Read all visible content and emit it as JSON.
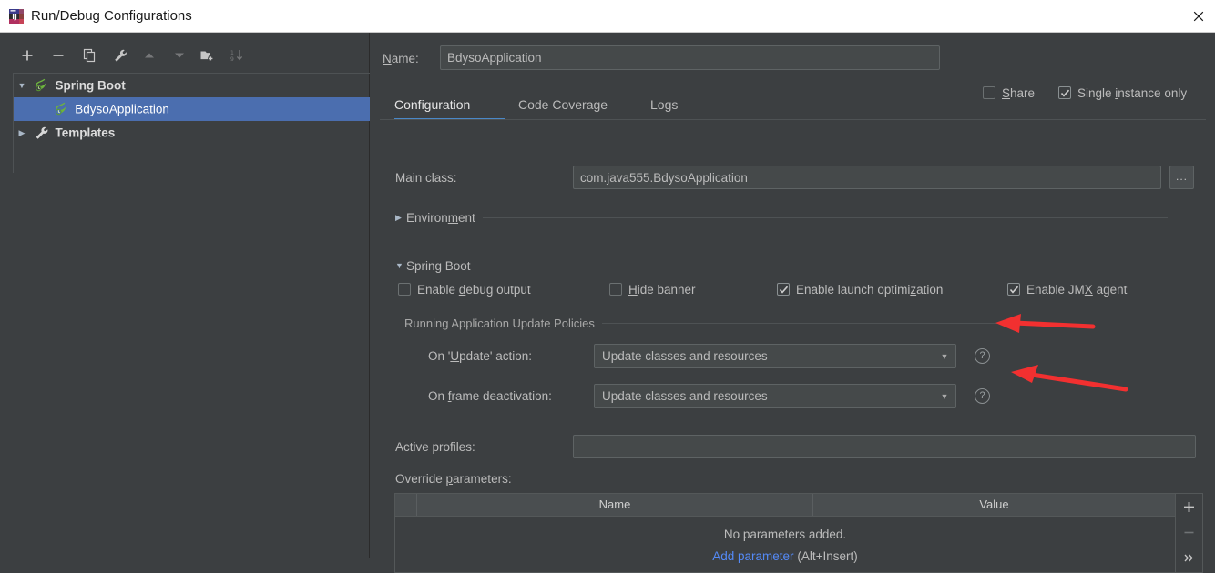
{
  "window": {
    "title": "Run/Debug Configurations",
    "app_icon": "intellij-idea-icon",
    "close_icon": "close-icon"
  },
  "colors": {
    "panel_bg": "#3c3f41",
    "field_bg": "#45494a",
    "selection_blue": "#4b6eaf",
    "tab_accent": "#4a88c7",
    "link_blue": "#548af7",
    "annotation_red": "#f03030",
    "text": "#bbbbbb",
    "title_bar_bg": "#ffffff"
  },
  "tree_toolbar": {
    "buttons": [
      {
        "name": "add-configuration-button",
        "icon": "plus-icon",
        "enabled": true
      },
      {
        "name": "remove-configuration-button",
        "icon": "minus-icon",
        "enabled": true
      },
      {
        "name": "copy-configuration-button",
        "icon": "copy-icon",
        "enabled": true
      },
      {
        "name": "edit-templates-button",
        "icon": "wrench-icon",
        "enabled": true
      },
      {
        "name": "move-up-button",
        "icon": "arrow-up-icon",
        "enabled": false
      },
      {
        "name": "move-down-button",
        "icon": "arrow-down-icon",
        "enabled": false
      },
      {
        "name": "new-folder-button",
        "icon": "folder-add-icon",
        "enabled": true
      },
      {
        "name": "sort-configurations-button",
        "icon": "sort-icon",
        "enabled": false
      }
    ]
  },
  "tree": {
    "items": [
      {
        "label": "Spring Boot",
        "icon": "spring-boot-icon",
        "twisty": "▼",
        "expanded": true,
        "selected": false,
        "level": 0
      },
      {
        "label": "BdysoApplication",
        "icon": "spring-boot-icon",
        "twisty": "",
        "expanded": false,
        "selected": true,
        "level": 1
      },
      {
        "label": "Templates",
        "icon": "wrench-icon",
        "twisty": "▶",
        "expanded": false,
        "selected": false,
        "level": 0
      }
    ]
  },
  "form": {
    "name_label": "Name:",
    "name_value": "BdysoApplication",
    "share": {
      "label": "Share",
      "checked": false,
      "mnemonic": "S"
    },
    "single_instance": {
      "label": "Single instance only",
      "checked": true,
      "mnemonic": "i"
    },
    "tabs": [
      {
        "label": "Configuration",
        "active": true
      },
      {
        "label": "Code Coverage",
        "active": false
      },
      {
        "label": "Logs",
        "active": false
      }
    ],
    "main_class": {
      "label": "Main class:",
      "value": "com.java555.BdysoApplication",
      "browse_label": "..."
    },
    "environment_section": {
      "label": "Environment",
      "expanded": false,
      "arrow": "▶"
    },
    "spring_boot_section": {
      "label": "Spring Boot",
      "expanded": true,
      "arrow": "▼"
    },
    "spring_boot_options": [
      {
        "label": "Enable debug output",
        "checked": false,
        "name": "enable-debug-output-checkbox"
      },
      {
        "label": "Hide banner",
        "checked": false,
        "name": "hide-banner-checkbox"
      },
      {
        "label": "Enable launch optimization",
        "checked": true,
        "name": "enable-launch-optimization-checkbox"
      },
      {
        "label": "Enable JMX agent",
        "checked": true,
        "name": "enable-jmx-agent-checkbox"
      }
    ],
    "update_policies_title": "Running Application Update Policies",
    "on_update_action": {
      "label": "On 'Update' action:",
      "value": "Update classes and resources",
      "help": "?"
    },
    "on_frame_deactivation": {
      "label": "On frame deactivation:",
      "value": "Update classes and resources",
      "help": "?"
    },
    "active_profiles": {
      "label": "Active profiles:",
      "value": "",
      "placeholder": ""
    },
    "override_parameters": {
      "label": "Override parameters:",
      "columns": [
        "Name",
        "Value"
      ],
      "rows": [],
      "empty_text": "No parameters added.",
      "add_link": "Add parameter",
      "add_shortcut": "(Alt+Insert)",
      "side_buttons": [
        {
          "name": "add-parameter-button",
          "icon": "plus-icon",
          "enabled": true
        },
        {
          "name": "remove-parameter-button",
          "icon": "minus-icon",
          "enabled": false
        },
        {
          "name": "expand-parameters-button",
          "icon": "chevron-double-right-icon",
          "enabled": true
        }
      ]
    }
  },
  "annotations": [
    {
      "name": "arrow-to-update-action-help",
      "shape": "left-arrow"
    },
    {
      "name": "arrow-to-frame-deactivation-help",
      "shape": "left-arrow"
    }
  ]
}
